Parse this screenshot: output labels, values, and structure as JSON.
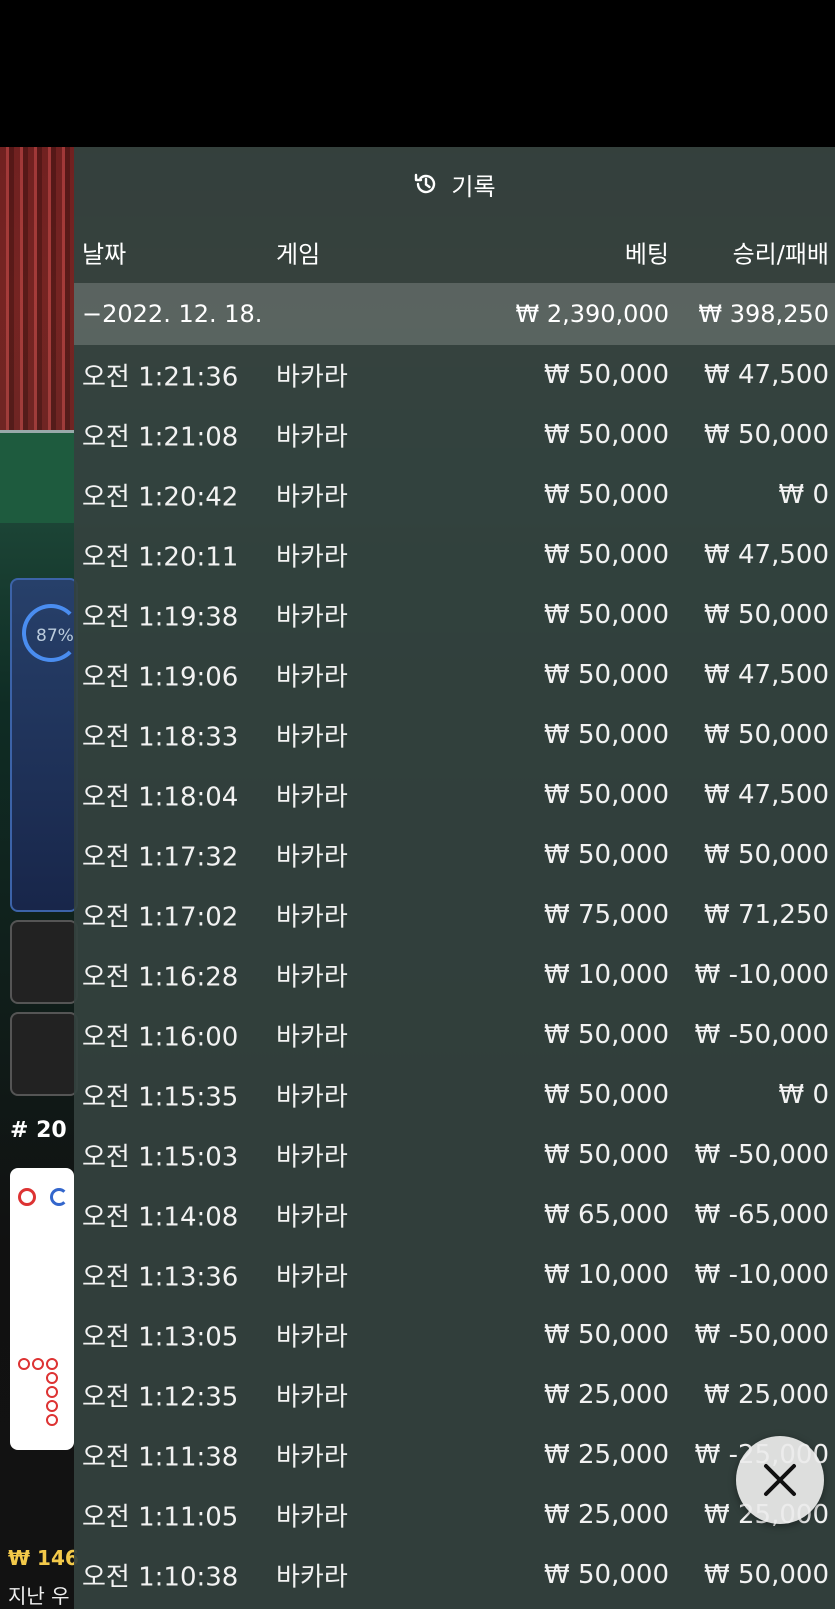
{
  "header": {
    "title": "기록",
    "icon": "history-icon"
  },
  "columns": {
    "date": "날짜",
    "game": "게임",
    "bet": "베팅",
    "result": "승리/패배"
  },
  "summary": {
    "date": "−2022. 12. 18.",
    "bet": "₩ 2,390,000",
    "result": "₩ 398,250"
  },
  "rows": [
    {
      "time": "오전 1:21:36",
      "game": "바카라",
      "bet": "₩ 50,000",
      "result": "₩ 47,500"
    },
    {
      "time": "오전 1:21:08",
      "game": "바카라",
      "bet": "₩ 50,000",
      "result": "₩ 50,000"
    },
    {
      "time": "오전 1:20:42",
      "game": "바카라",
      "bet": "₩ 50,000",
      "result": "₩ 0"
    },
    {
      "time": "오전 1:20:11",
      "game": "바카라",
      "bet": "₩ 50,000",
      "result": "₩ 47,500"
    },
    {
      "time": "오전 1:19:38",
      "game": "바카라",
      "bet": "₩ 50,000",
      "result": "₩ 50,000"
    },
    {
      "time": "오전 1:19:06",
      "game": "바카라",
      "bet": "₩ 50,000",
      "result": "₩ 47,500"
    },
    {
      "time": "오전 1:18:33",
      "game": "바카라",
      "bet": "₩ 50,000",
      "result": "₩ 50,000"
    },
    {
      "time": "오전 1:18:04",
      "game": "바카라",
      "bet": "₩ 50,000",
      "result": "₩ 47,500"
    },
    {
      "time": "오전 1:17:32",
      "game": "바카라",
      "bet": "₩ 50,000",
      "result": "₩ 50,000"
    },
    {
      "time": "오전 1:17:02",
      "game": "바카라",
      "bet": "₩ 75,000",
      "result": "₩ 71,250"
    },
    {
      "time": "오전 1:16:28",
      "game": "바카라",
      "bet": "₩ 10,000",
      "result": "₩ -10,000"
    },
    {
      "time": "오전 1:16:00",
      "game": "바카라",
      "bet": "₩ 50,000",
      "result": "₩ -50,000"
    },
    {
      "time": "오전 1:15:35",
      "game": "바카라",
      "bet": "₩ 50,000",
      "result": "₩ 0"
    },
    {
      "time": "오전 1:15:03",
      "game": "바카라",
      "bet": "₩ 50,000",
      "result": "₩ -50,000"
    },
    {
      "time": "오전 1:14:08",
      "game": "바카라",
      "bet": "₩ 65,000",
      "result": "₩ -65,000"
    },
    {
      "time": "오전 1:13:36",
      "game": "바카라",
      "bet": "₩ 10,000",
      "result": "₩ -10,000"
    },
    {
      "time": "오전 1:13:05",
      "game": "바카라",
      "bet": "₩ 50,000",
      "result": "₩ -50,000"
    },
    {
      "time": "오전 1:12:35",
      "game": "바카라",
      "bet": "₩ 25,000",
      "result": "₩ 25,000"
    },
    {
      "time": "오전 1:11:38",
      "game": "바카라",
      "bet": "₩ 25,000",
      "result": "₩ -25,000"
    },
    {
      "time": "오전 1:11:05",
      "game": "바카라",
      "bet": "₩ 25,000",
      "result": "₩ 25,000"
    },
    {
      "time": "오전 1:10:38",
      "game": "바카라",
      "bet": "₩ 50,000",
      "result": "₩ 50,000"
    }
  ],
  "background": {
    "timer": "87%",
    "round": "# 20",
    "balance": "₩ 146",
    "last_label": "지난 우"
  },
  "close_button": {
    "icon": "close-icon"
  }
}
